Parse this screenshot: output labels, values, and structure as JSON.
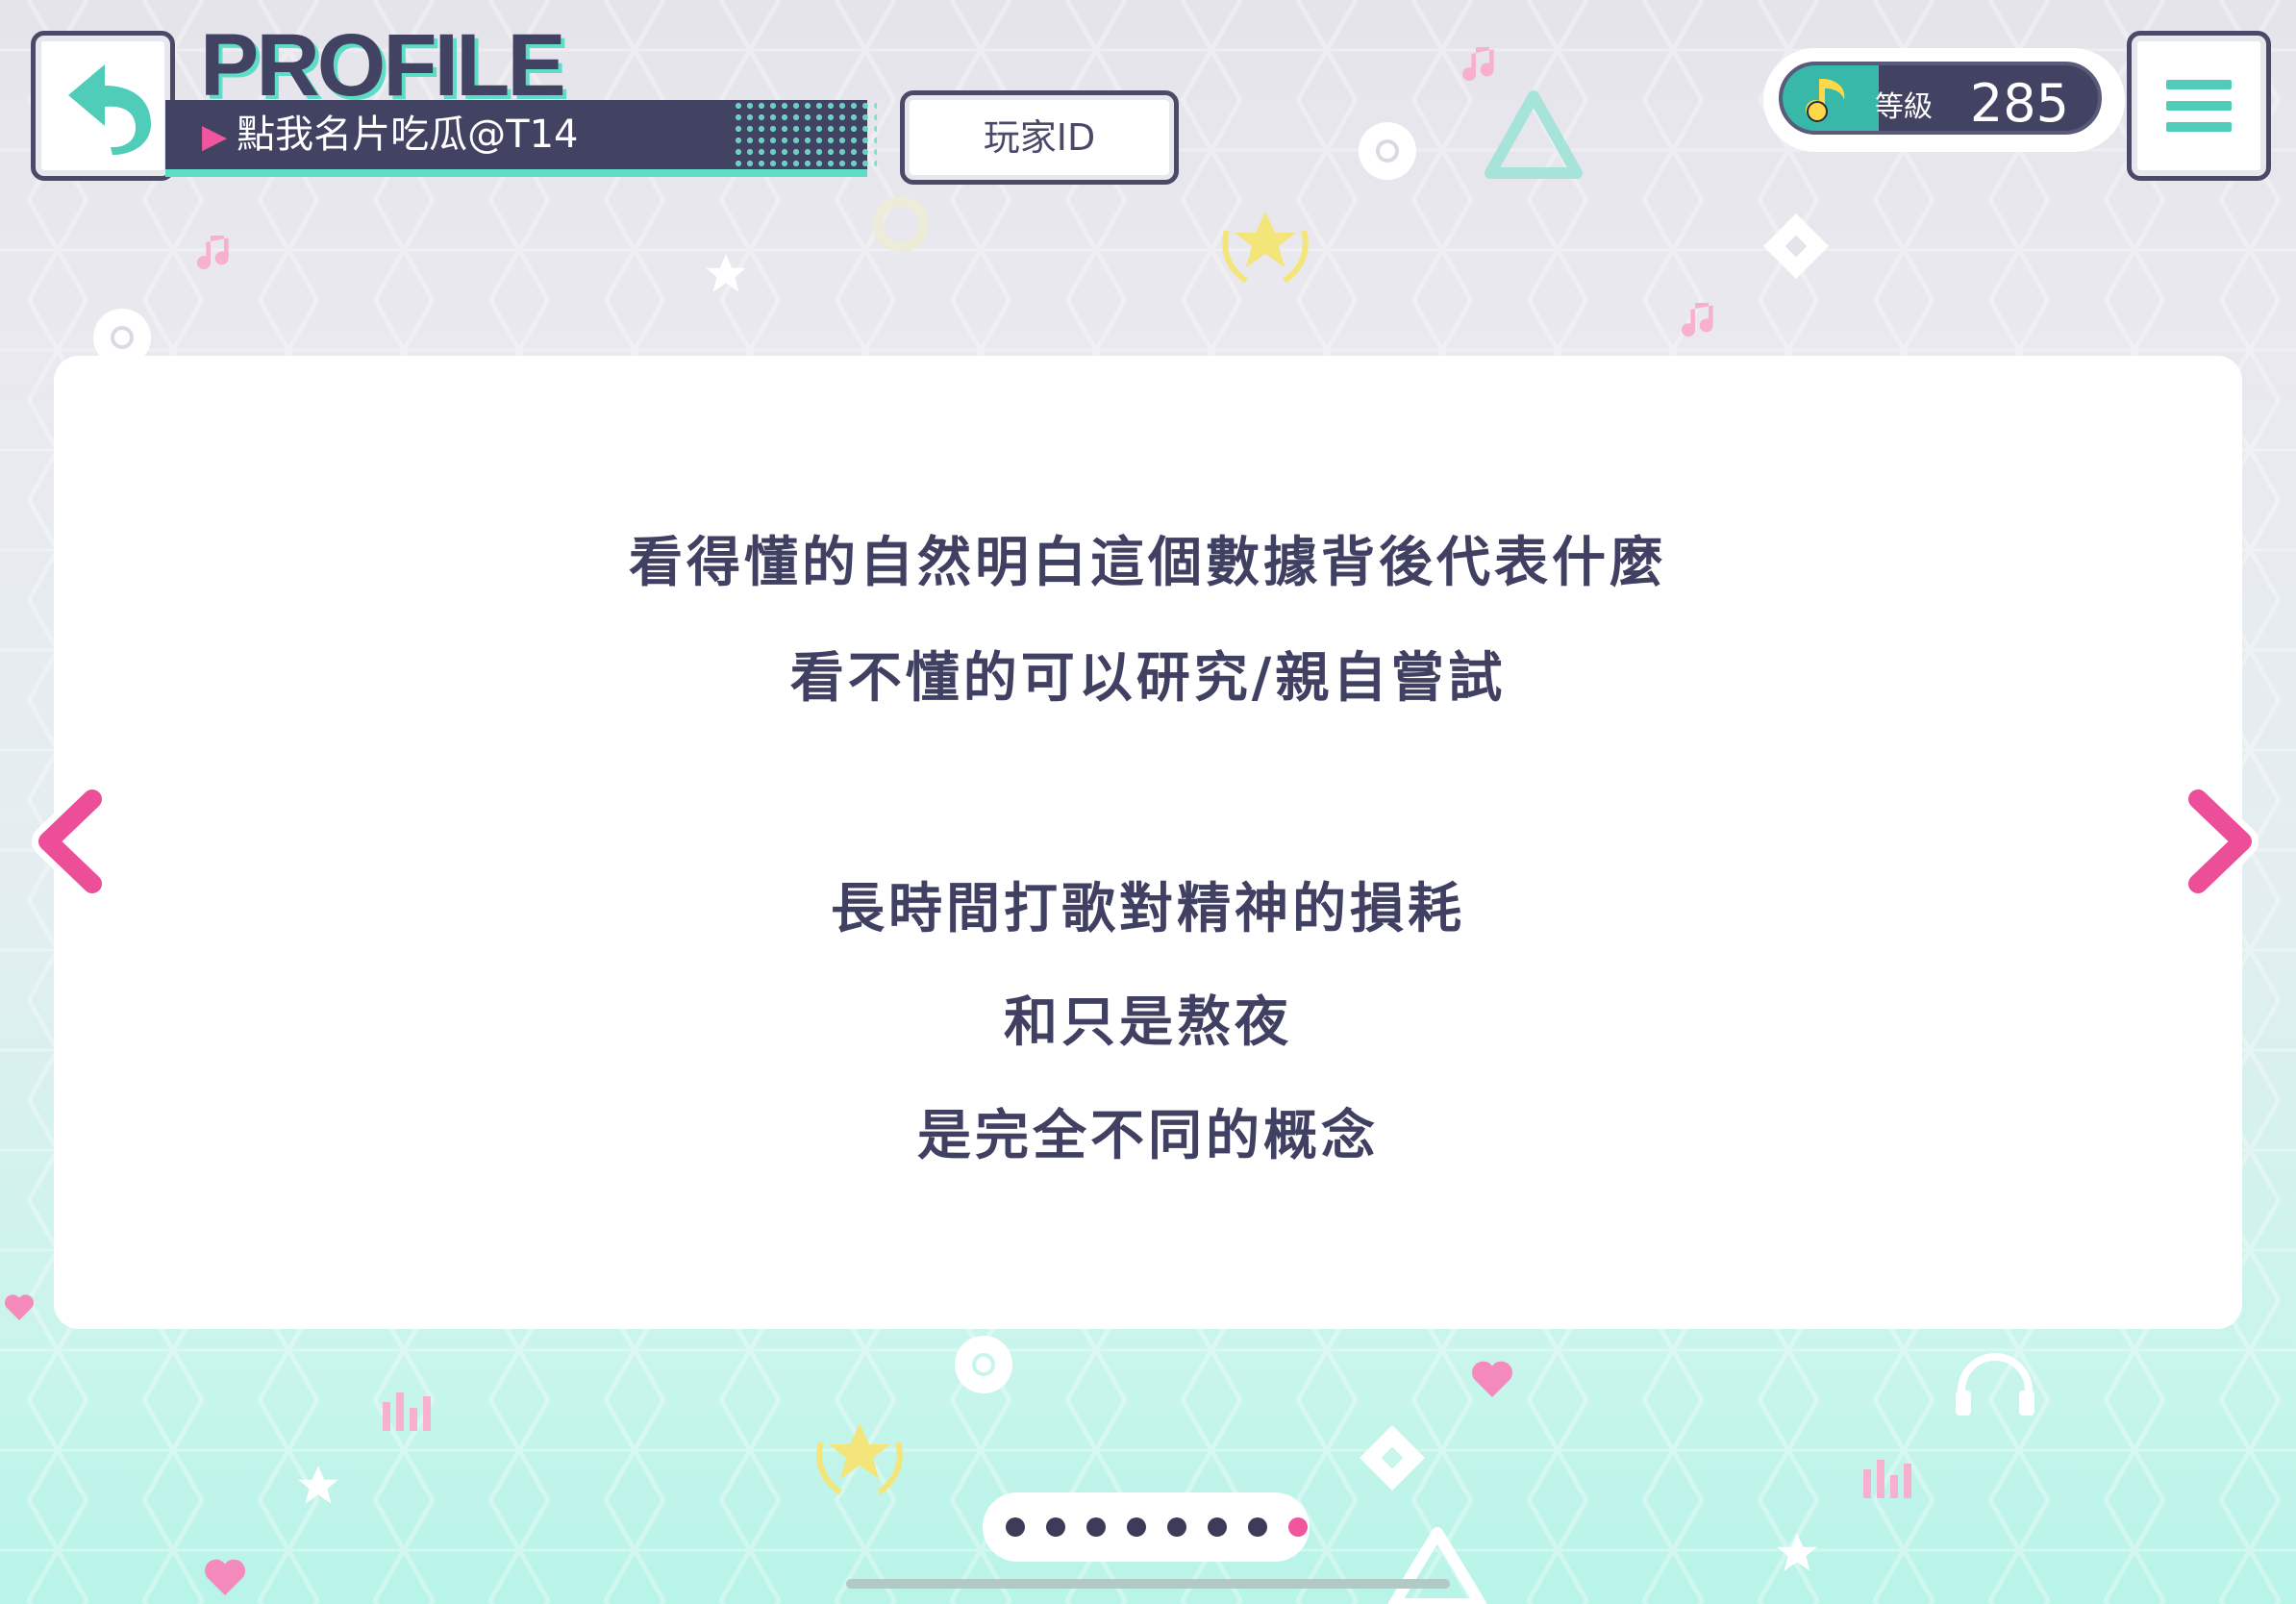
{
  "header": {
    "title": "PROFILE",
    "player_name": "點我名片吃瓜@T14",
    "player_id_button": "玩家ID"
  },
  "level": {
    "label": "等級",
    "value": "285"
  },
  "icons": {
    "back": "back-arrow-icon",
    "menu": "hamburger-menu-icon",
    "level": "music-note-icon",
    "prev": "chevron-left-icon",
    "next": "chevron-right-icon"
  },
  "content": {
    "lines": [
      "看得懂的自然明白這個數據背後代表什麼",
      "看不懂的可以研究/親自嘗試",
      "長時間打歌對精神的損耗",
      "和只是熬夜",
      "是完全不同的概念"
    ]
  },
  "pager": {
    "total": 8,
    "current": 8
  },
  "colors": {
    "accent_teal": "#5ddcc6",
    "accent_pink": "#f0559e",
    "dark_navy": "#424263"
  }
}
